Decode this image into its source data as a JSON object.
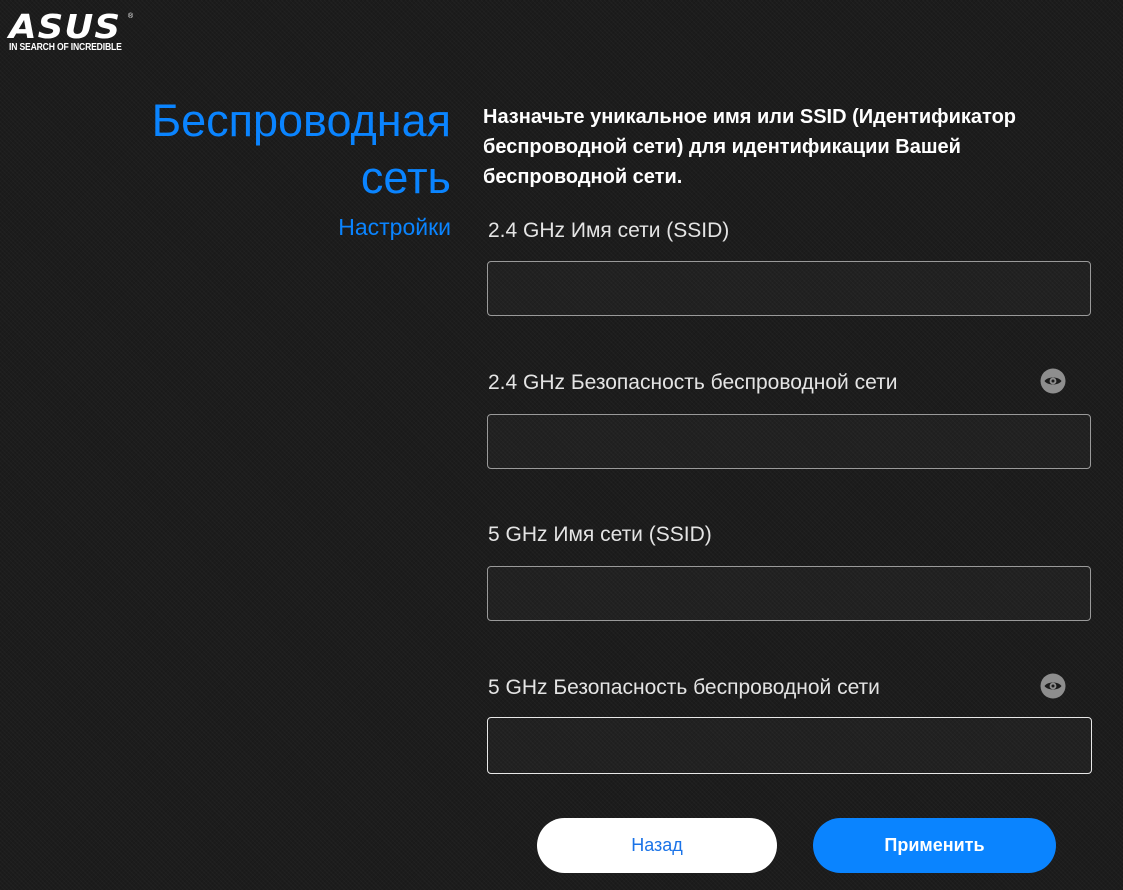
{
  "brand": {
    "logo_text": "ASUS",
    "registered_mark": "®",
    "tagline": "IN SEARCH OF INCREDIBLE"
  },
  "page": {
    "title_line1": "Беспроводная",
    "title_line2": "сеть",
    "subtitle": "Настройки",
    "description": "Назначьте уникальное имя или SSID (Идентификатор беспроводной сети) для идентификации Вашей беспроводной сети."
  },
  "fields": [
    {
      "label": "2.4 GHz Имя сети (SSID)",
      "value": "",
      "has_visibility_toggle": false
    },
    {
      "label": "2.4 GHz Безопасность беспроводной сети",
      "value": "",
      "has_visibility_toggle": true,
      "toggle_icon": "eye-icon"
    },
    {
      "label": "5 GHz Имя сети (SSID)",
      "value": "",
      "has_visibility_toggle": false
    },
    {
      "label": "5 GHz Безопасность беспроводной сети",
      "value": "",
      "has_visibility_toggle": true,
      "toggle_icon": "eye-icon",
      "focused": true
    }
  ],
  "buttons": {
    "back_label": "Назад",
    "apply_label": "Применить"
  },
  "colors": {
    "accent": "#0a84ff",
    "background": "#1c1c1c",
    "back_button_bg": "#ffffff",
    "back_button_text": "#1a73e8",
    "input_border": "#9a9a9a"
  }
}
